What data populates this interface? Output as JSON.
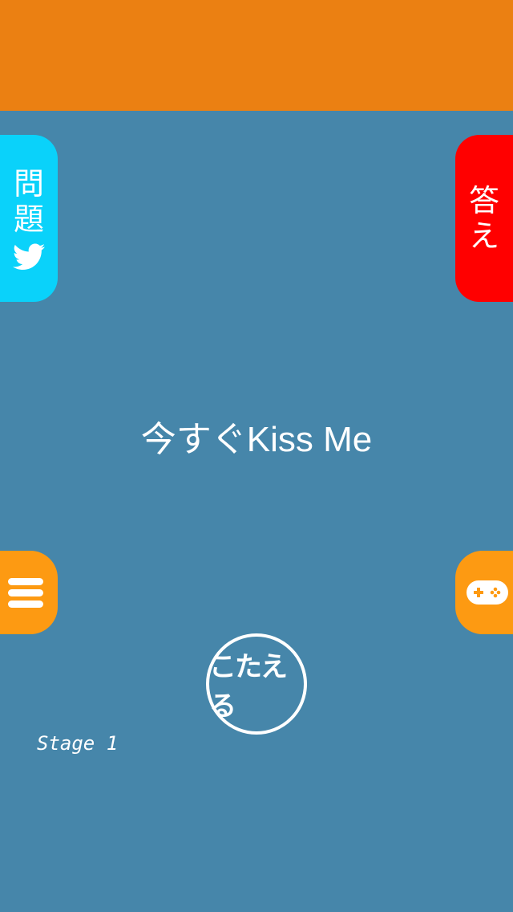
{
  "colors": {
    "background": "#4686aa",
    "top_banner": "#eb8012",
    "question_tab": "#0ad2fa",
    "answer_tab": "#ff0000",
    "menu_tab": "#fd9a12",
    "game_tab": "#fd9a12",
    "text": "#ffffff"
  },
  "question_tab": {
    "char1": "問",
    "char2": "題",
    "icon": "twitter-icon"
  },
  "answer_tab": {
    "char1": "答",
    "char2": "え"
  },
  "menu_tab": {
    "icon": "hamburger-icon"
  },
  "game_tab": {
    "icon": "gamepad-icon"
  },
  "question": {
    "text": "今すぐKiss Me"
  },
  "answer_button": {
    "label": "こたえる"
  },
  "stage": {
    "label": "Stage 1"
  }
}
